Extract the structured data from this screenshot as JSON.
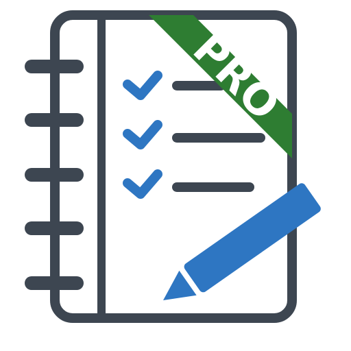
{
  "icon": {
    "name": "checklist-notebook-pro-icon",
    "badge_label": "PRO",
    "checklist_items": 3,
    "colors": {
      "outline": "#3d4651",
      "page": "#ffffff",
      "check": "#2e76c2",
      "ribbon": "#2e7d32",
      "ribbon_text": "#ffffff",
      "pencil": "#2e76c2"
    }
  }
}
